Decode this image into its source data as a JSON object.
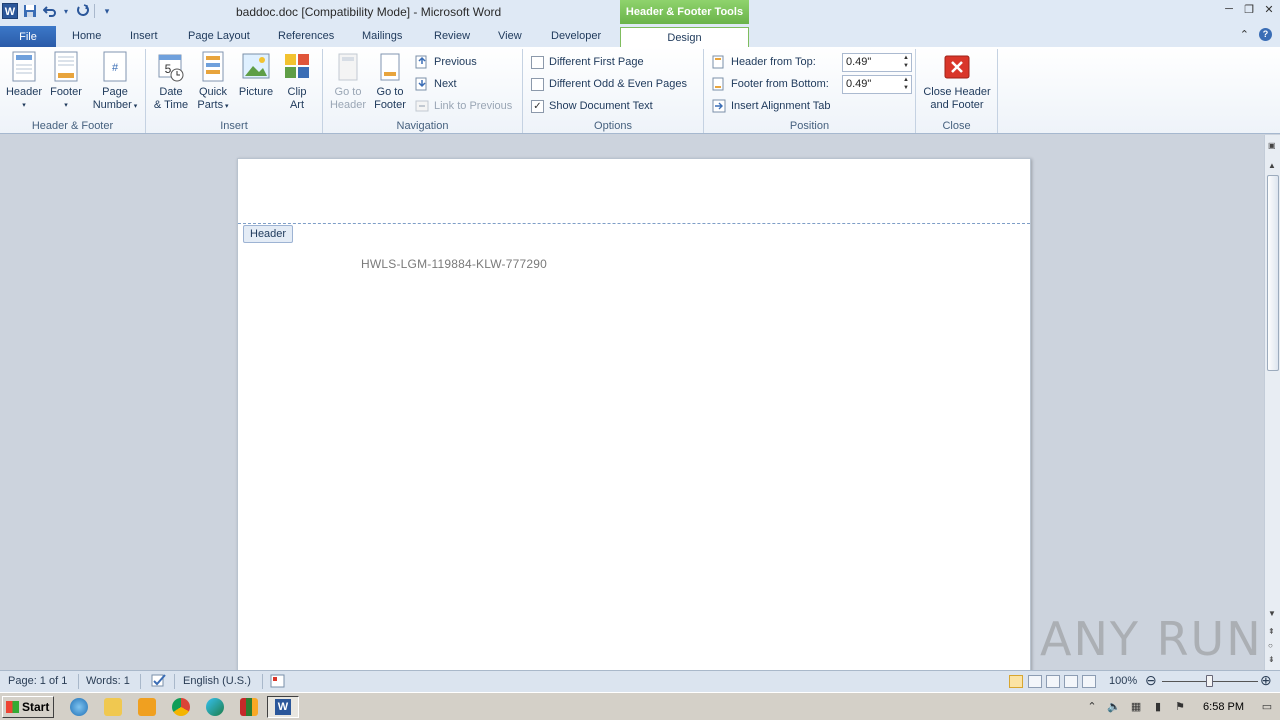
{
  "window": {
    "title": "baddoc.doc [Compatibility Mode]  -  Microsoft Word",
    "contextual_tab_title": "Header & Footer Tools"
  },
  "qat": {
    "word_logo": "W",
    "icons": [
      "save-icon",
      "undo-icon",
      "redo-icon",
      "customize-icon"
    ]
  },
  "tabs": [
    {
      "label": "File"
    },
    {
      "label": "Home"
    },
    {
      "label": "Insert"
    },
    {
      "label": "Page Layout"
    },
    {
      "label": "References"
    },
    {
      "label": "Mailings"
    },
    {
      "label": "Review"
    },
    {
      "label": "View"
    },
    {
      "label": "Developer"
    },
    {
      "label": "Design"
    }
  ],
  "ribbon": {
    "hf_group": {
      "label": "Header & Footer",
      "header": "Header",
      "footer": "Footer",
      "page": "Page",
      "number": "Number"
    },
    "insert_group": {
      "label": "Insert",
      "date1": "Date",
      "date2": "& Time",
      "quick1": "Quick",
      "quick2": "Parts",
      "picture": "Picture",
      "clip1": "Clip",
      "clip2": "Art"
    },
    "nav_group": {
      "label": "Navigation",
      "goh1": "Go to",
      "goh2": "Header",
      "gof1": "Go to",
      "gof2": "Footer",
      "previous": "Previous",
      "next": "Next",
      "link": "Link to Previous"
    },
    "options_group": {
      "label": "Options",
      "diff_first": "Different First Page",
      "diff_odd": "Different Odd & Even Pages",
      "show_doc": "Show Document Text",
      "show_doc_checked": true
    },
    "position_group": {
      "label": "Position",
      "header_top": "Header from Top:",
      "header_top_value": "0.49\"",
      "footer_bottom": "Footer from Bottom:",
      "footer_bottom_value": "0.49\"",
      "align_tab": "Insert Alignment Tab"
    },
    "close_group": {
      "label": "Close",
      "close1": "Close Header",
      "close2": "and Footer"
    }
  },
  "document": {
    "header_tag": "Header",
    "body_text": "HWLS-LGM-119884-KLW-777290"
  },
  "status": {
    "page": "Page: 1 of 1",
    "words": "Words: 1",
    "language": "English (U.S.)",
    "zoom": "100%"
  },
  "taskbar": {
    "start": "Start",
    "time": "6:58 PM"
  },
  "watermark": "ANY RUN",
  "colors": {
    "file_tab": "#2a5aa7",
    "contextual": "#6ab34a",
    "ribbon_bg": "#eef3f9"
  }
}
